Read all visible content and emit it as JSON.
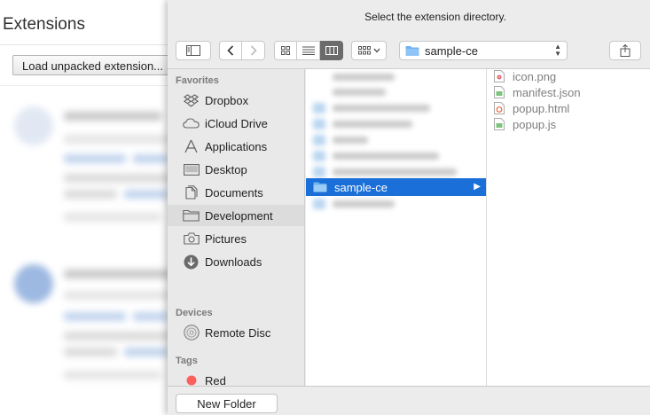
{
  "background_page": {
    "title": "Extensions",
    "load_unpacked_label": "Load unpacked extension..."
  },
  "dialog": {
    "title": "Select the extension directory.",
    "toolbar": {
      "sidebar_toggle_icon": "sidebar-icon",
      "back_icon": "chevron-left-icon",
      "forward_icon": "chevron-right-icon",
      "view_modes": [
        "icon-view",
        "list-view",
        "column-view"
      ],
      "active_view": "column-view",
      "arrange_icon": "grid-arrange-icon",
      "path_label": "sample-ce",
      "share_icon": "share-icon"
    },
    "sidebar": {
      "favorites_header": "Favorites",
      "favorites": [
        {
          "label": "Dropbox",
          "icon": "dropbox-icon"
        },
        {
          "label": "iCloud Drive",
          "icon": "cloud-icon"
        },
        {
          "label": "Applications",
          "icon": "applications-icon"
        },
        {
          "label": "Desktop",
          "icon": "desktop-icon"
        },
        {
          "label": "Documents",
          "icon": "documents-icon"
        },
        {
          "label": "Development",
          "icon": "folder-icon",
          "selected": true
        },
        {
          "label": "Pictures",
          "icon": "camera-icon"
        },
        {
          "label": "Downloads",
          "icon": "download-icon"
        }
      ],
      "devices_header": "Devices",
      "devices": [
        {
          "label": "Remote Disc",
          "icon": "disc-icon"
        }
      ],
      "tags_header": "Tags",
      "tags": [
        {
          "label": "Red",
          "color": "#fc605c"
        }
      ]
    },
    "column1": {
      "selected_folder": "sample-ce"
    },
    "column2": {
      "files": [
        {
          "name": "icon.png",
          "icon": "image-file-icon"
        },
        {
          "name": "manifest.json",
          "icon": "json-file-icon"
        },
        {
          "name": "popup.html",
          "icon": "html-file-icon"
        },
        {
          "name": "popup.js",
          "icon": "js-file-icon"
        }
      ]
    },
    "new_folder_label": "New Folder",
    "colors": {
      "selection": "#1a6fd8",
      "tag_red": "#fc605c",
      "folder_blue": "#6db3f2"
    }
  }
}
